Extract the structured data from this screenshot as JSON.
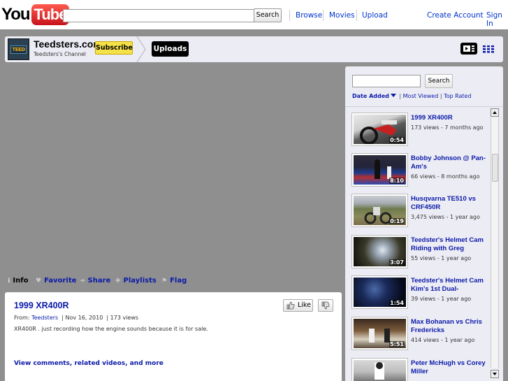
{
  "masthead": {
    "logo_you": "You",
    "logo_tube": "Tube",
    "search_value": "",
    "search_button": "Search",
    "nav": [
      "Browse",
      "Movies",
      "Upload"
    ],
    "create_account": "Create Account",
    "sign_in": "Sign In"
  },
  "channel": {
    "avatar_text": "TEED",
    "title": "Teedsters.com",
    "subtitle": "Teedsters's Channel",
    "subscribe": "Subscribe",
    "tab": "Uploads",
    "view_player_icon": "player-view-icon",
    "view_grid_icon": "grid-view-icon"
  },
  "actions": {
    "info": "Info",
    "favorite": "Favorite",
    "share": "Share",
    "playlists": "Playlists",
    "flag": "Flag"
  },
  "video": {
    "title": "1999 XR400R",
    "from_label": "From:",
    "author": "Teedsters",
    "date": "Nov 16, 2010",
    "views": "173 views",
    "description": "XR400R . just recording how the engine sounds because it is for sale.",
    "more_link": "View comments, related videos, and more",
    "like": "Like"
  },
  "sidebar": {
    "search_value": "",
    "search_button": "Search",
    "sort_active": "Date Added",
    "sort_sep1": " | ",
    "sort_most_viewed": "Most Viewed",
    "sort_sep2": " | ",
    "sort_top_rated": "Top Rated",
    "items": [
      {
        "title": "1999 XR400R",
        "meta": "173 views - 7 months ago",
        "duration": "0:54"
      },
      {
        "title": "Bobby Johnson @ Pan-Am's",
        "meta": "66 views - 8 months ago",
        "duration": "8:10"
      },
      {
        "title": "Husqvarna TE510 vs CRF450R",
        "meta": "3,475 views - 1 year ago",
        "duration": "0:19"
      },
      {
        "title": "Teedster's Helmet Cam Riding with Greg",
        "meta": "55 views - 1 year ago",
        "duration": "3:07"
      },
      {
        "title": "Teedster's Helmet Cam Kim's 1st Dual-",
        "meta": "39 views - 1 year ago",
        "duration": "1:54"
      },
      {
        "title": "Max Bohanan vs Chris Fredericks",
        "meta": "414 views - 1 year ago",
        "duration": "5:51"
      },
      {
        "title": "Peter McHugh vs Corey Miller",
        "meta": "",
        "duration": ""
      }
    ]
  }
}
